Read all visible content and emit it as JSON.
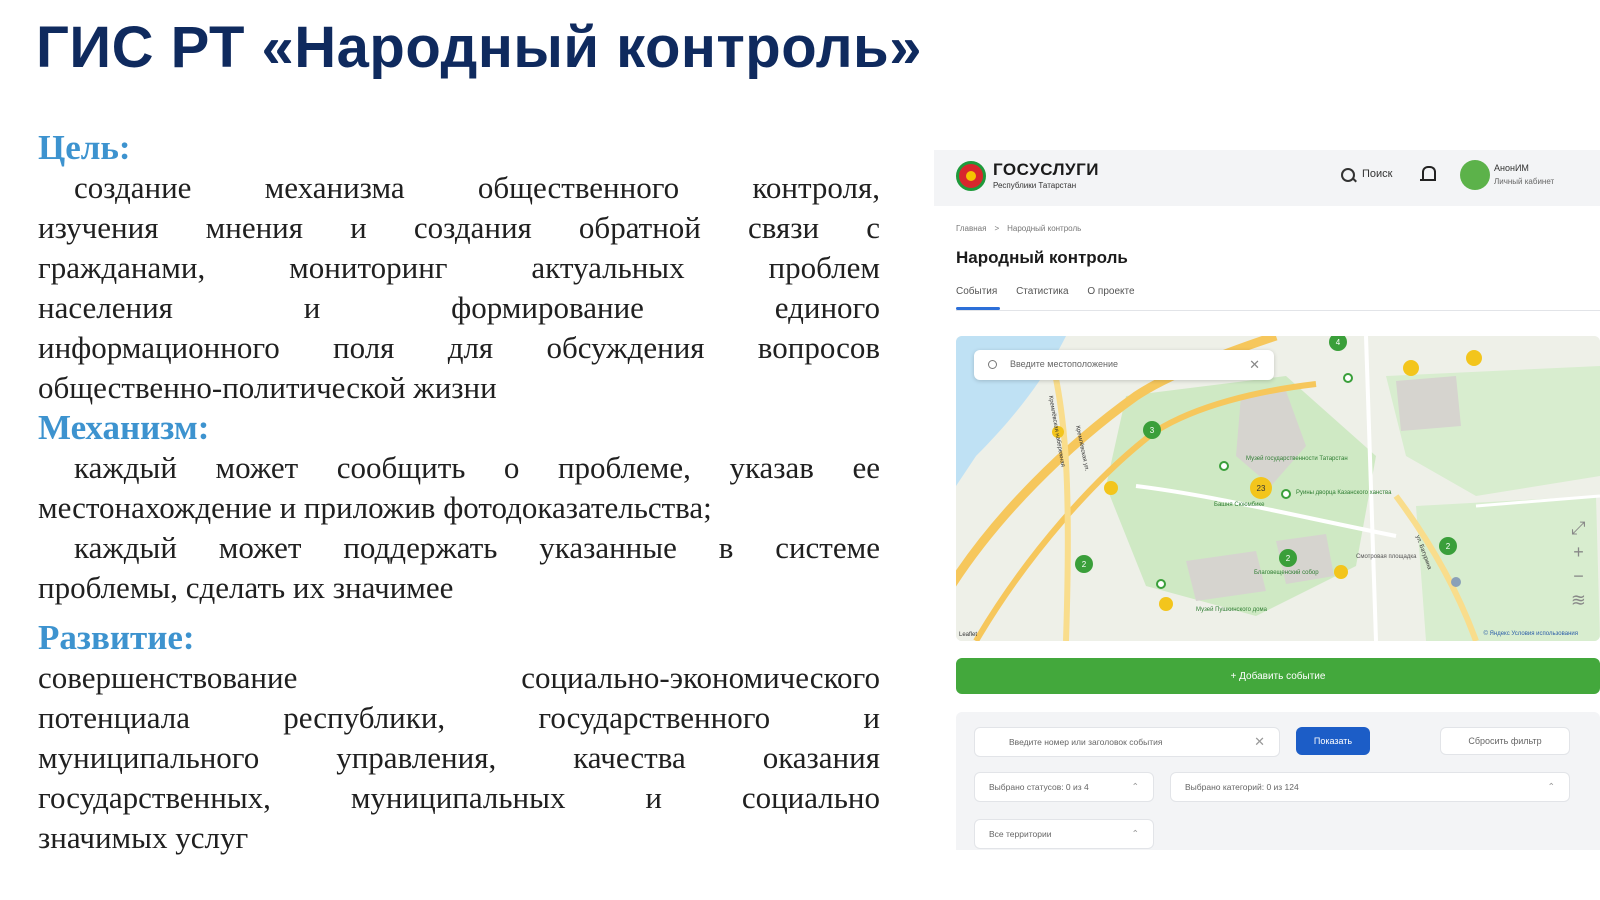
{
  "slide": {
    "title": "ГИС РТ «Народный контроль»",
    "goal": {
      "heading": "Цель:",
      "lines": [
        "создание механизма общественного контроля,",
        "изучения мнения и создания обратной связи с",
        "гражданами, мониторинг актуальных проблем",
        "населения и формирование единого",
        "информационного поля для обсуждения вопросов",
        "общественно-политической жизни"
      ]
    },
    "mechanism": {
      "heading": "Механизм:",
      "item1_lines": [
        "каждый может сообщить о проблеме, указав ее",
        "местонахождение и приложив фотодоказательства;"
      ],
      "item2_lines": [
        "каждый может поддержать указанные в системе",
        "проблемы, сделать их значимее"
      ]
    },
    "development": {
      "heading": "Развитие:",
      "lines": [
        "совершенствование социально-экономического",
        "потенциала республики, государственного и",
        "муниципального управления, качества оказания",
        "государственных, муниципальных и социально",
        "значимых услуг"
      ]
    }
  },
  "screenshot": {
    "header": {
      "brand": "ГОСУСЛУГИ",
      "brand_sub": "Республики Татарстан",
      "search_label": "Поиск",
      "user_name": "АнонИМ",
      "user_sub": "Личный кабинет"
    },
    "breadcrumb": [
      "Главная",
      "Народный контроль"
    ],
    "page_title": "Народный контроль",
    "tabs": [
      "События",
      "Статистика",
      "О проекте"
    ],
    "map": {
      "search_placeholder": "Введите местоположение",
      "clusters": [
        "4",
        "3",
        "23",
        "2",
        "2",
        "2"
      ],
      "labels": [
        "Музей государственности Татарстан",
        "Башня Сююмбике",
        "Руины дворца Казанского ханства",
        "Благовещенский собор",
        "Смотровая площадка",
        "Музей Пушкинского дома",
        "ул. Батурина",
        "Кремлёвская ул.",
        "Кремлёвская набережная"
      ],
      "attribution_left": "Leaflet",
      "attribution_right": "© Яндекс Условия использования"
    },
    "add_event_label": "+ Добавить событие",
    "filters": {
      "search_placeholder": "Введите номер или заголовок события",
      "show_label": "Показать",
      "reset_label": "Сбросить фильтр",
      "statuses": "Выбрано статусов: 0 из 4",
      "categories": "Выбрано категорий: 0 из 124",
      "territories": "Все территории"
    },
    "colors": {
      "accent_green": "#43a83c",
      "accent_blue": "#1c5dc7",
      "title_blue": "#0f2a5e",
      "heading_blue": "#3d93cf"
    }
  }
}
